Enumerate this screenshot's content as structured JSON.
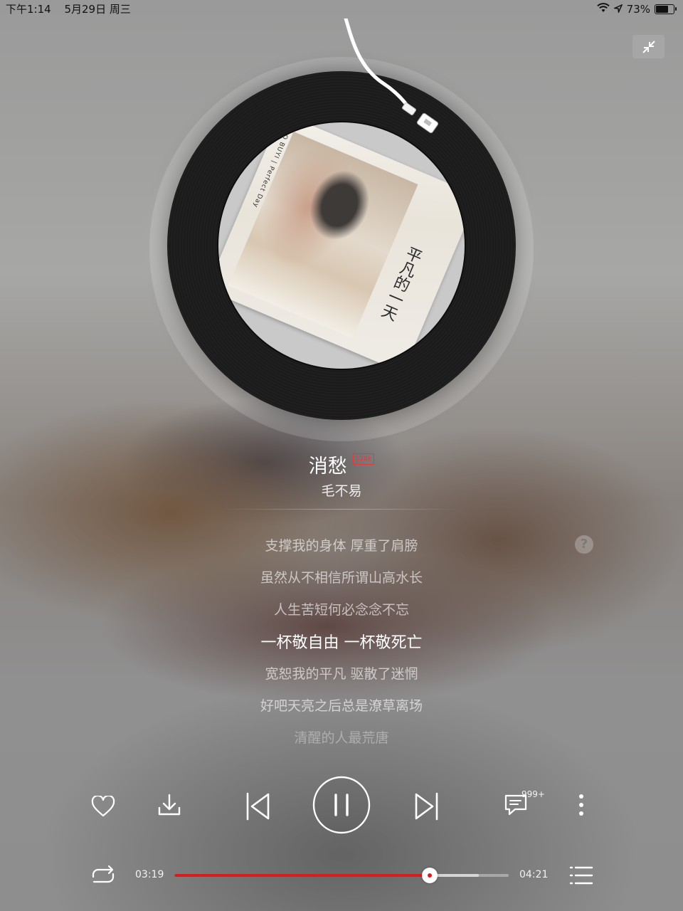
{
  "status_bar": {
    "time": "下午1:14",
    "date": "5月29日 周三",
    "battery": "73%",
    "battery_level": 0.73
  },
  "player": {
    "song_title": "消愁",
    "quality_badge": "128k",
    "artist": "毛不易",
    "album_art": {
      "spine_text": "MAO BUYI | Perfect Day",
      "calligraphy": "平凡的一天"
    },
    "lyrics": [
      "支撑我的身体 厚重了肩膀",
      "虽然从不相信所谓山高水长",
      "人生苦短何必念念不忘",
      "一杯敬自由 一杯敬死亡",
      "宽恕我的平凡 驱散了迷惘",
      "好吧天亮之后总是潦草离场",
      "清醒的人最荒唐"
    ],
    "active_lyric_index": 3,
    "comment_count": "999+",
    "current_time": "03:19",
    "total_time": "04:21",
    "progress": 0.763,
    "buffered": 0.91,
    "accent_color": "#d71d1d"
  }
}
